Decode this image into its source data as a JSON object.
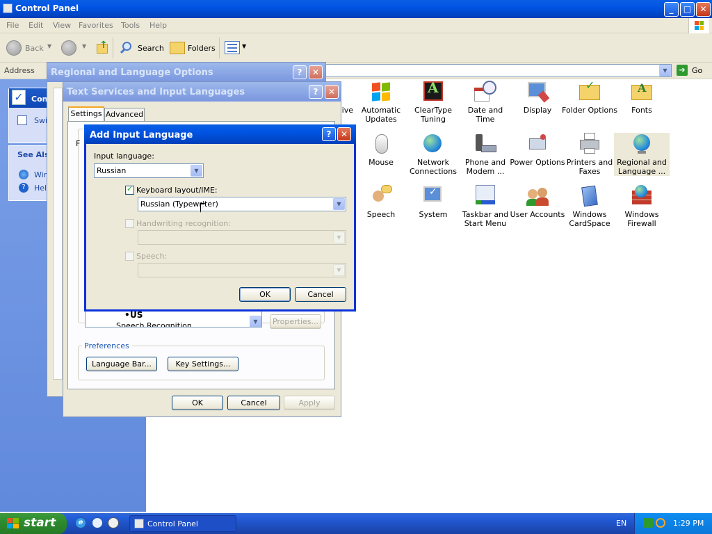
{
  "window": {
    "title": "Control Panel",
    "min": "_",
    "max": "□",
    "close": "✕"
  },
  "menu": [
    "File",
    "Edit",
    "View",
    "Favorites",
    "Tools",
    "Help"
  ],
  "toolbar": {
    "back": "Back",
    "search": "Search",
    "folders": "Folders"
  },
  "address": {
    "label": "Address",
    "go": "Go"
  },
  "left_panel": {
    "panel_title": "Con",
    "switch": "Swi",
    "see_also": "See Als",
    "item1": "Win",
    "item2": "Help"
  },
  "icons": [
    {
      "label": "ive",
      "name": "partial-icon"
    },
    {
      "label": "Automatic Updates",
      "name": "automatic-updates"
    },
    {
      "label": "ClearType Tuning",
      "name": "cleartype-tuning"
    },
    {
      "label": "Date and Time",
      "name": "date-and-time"
    },
    {
      "label": "Display",
      "name": "display"
    },
    {
      "label": "Folder Options",
      "name": "folder-options"
    },
    {
      "label": "Fonts",
      "name": "fonts"
    },
    {
      "label": "Mouse",
      "name": "mouse"
    },
    {
      "label": "Network Connections",
      "name": "network-connections"
    },
    {
      "label": "Phone and Modem ...",
      "name": "phone-and-modem"
    },
    {
      "label": "Power Options",
      "name": "power-options"
    },
    {
      "label": "Printers and Faxes",
      "name": "printers-and-faxes"
    },
    {
      "label": "Regional and Language ...",
      "name": "regional-and-language"
    },
    {
      "label": "Speech",
      "name": "speech"
    },
    {
      "label": "System",
      "name": "system"
    },
    {
      "label": "Taskbar and Start Menu",
      "name": "taskbar-and-start-menu"
    },
    {
      "label": "User Accounts",
      "name": "user-accounts"
    },
    {
      "label": "Windows CardSpace",
      "name": "windows-cardspace"
    },
    {
      "label": "Windows Firewall",
      "name": "windows-firewall"
    }
  ],
  "regional_dialog": {
    "title": "Regional and Language Options",
    "help": "?",
    "close": "✕"
  },
  "ts_dialog": {
    "title": "Text Services and Input Languages",
    "help": "?",
    "close": "✕",
    "tab_settings": "Settings",
    "tab_advanced": "Advanced",
    "tab_partial": "F",
    "lang_us": "US",
    "speech_partial": "Speech Recognition",
    "properties": "Properties...",
    "preferences": "Preferences",
    "language_bar": "Language Bar...",
    "key_settings": "Key Settings...",
    "ok": "OK",
    "cancel": "Cancel",
    "apply": "Apply"
  },
  "add_dialog": {
    "title": "Add Input Language",
    "help": "?",
    "close": "✕",
    "input_language_label": "Input language:",
    "input_language_value": "Russian",
    "keyboard_label": "Keyboard layout/IME:",
    "keyboard_value": "Russian (Typewriter)",
    "handwriting_label": "Handwriting recognition:",
    "speech_label": "Speech:",
    "ok": "OK",
    "cancel": "Cancel"
  },
  "taskbar": {
    "start": "start",
    "task": "Control Panel",
    "lang": "EN",
    "time": "1:29 PM"
  }
}
